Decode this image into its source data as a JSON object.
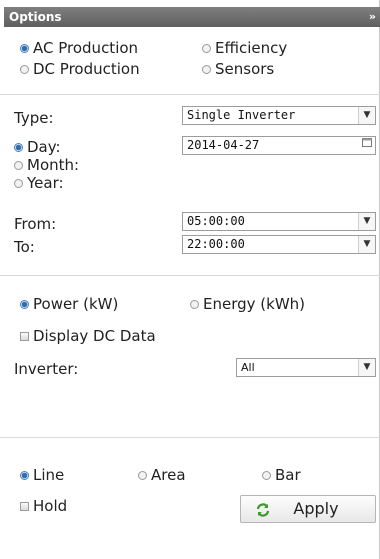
{
  "panel": {
    "title": "Options",
    "collapse_glyph": "»"
  },
  "views": {
    "ac_production": "AC Production",
    "efficiency": "Efficiency",
    "dc_production": "DC Production",
    "sensors": "Sensors",
    "selected": "ac_production"
  },
  "filters": {
    "type_label": "Type:",
    "type_value": "Single Inverter",
    "day_label": "Day:",
    "month_label": "Month:",
    "year_label": "Year:",
    "period_selected": "day",
    "date_value": "2014-04-27",
    "from_label": "From:",
    "from_value": "05:00:00",
    "to_label": "To:",
    "to_value": "22:00:00"
  },
  "measure": {
    "power_label": "Power (kW)",
    "energy_label": "Energy (kWh)",
    "selected": "power",
    "display_dc_label": "Display DC Data",
    "display_dc_checked": false,
    "inverter_label": "Inverter:",
    "inverter_value": "All"
  },
  "chart_style": {
    "line_label": "Line",
    "area_label": "Area",
    "bar_label": "Bar",
    "selected": "line",
    "hold_label": "Hold",
    "hold_checked": false,
    "apply_label": "Apply"
  },
  "icons": {
    "calendar": "calendar-icon",
    "dropdown": "chevron-down-icon",
    "apply": "refresh-icon",
    "collapse": "double-chevron-right-icon"
  },
  "colors": {
    "titlebar": "#6f6f6f",
    "radio_selected": "#2f6db1",
    "apply_icon": "#3a9a2a"
  }
}
